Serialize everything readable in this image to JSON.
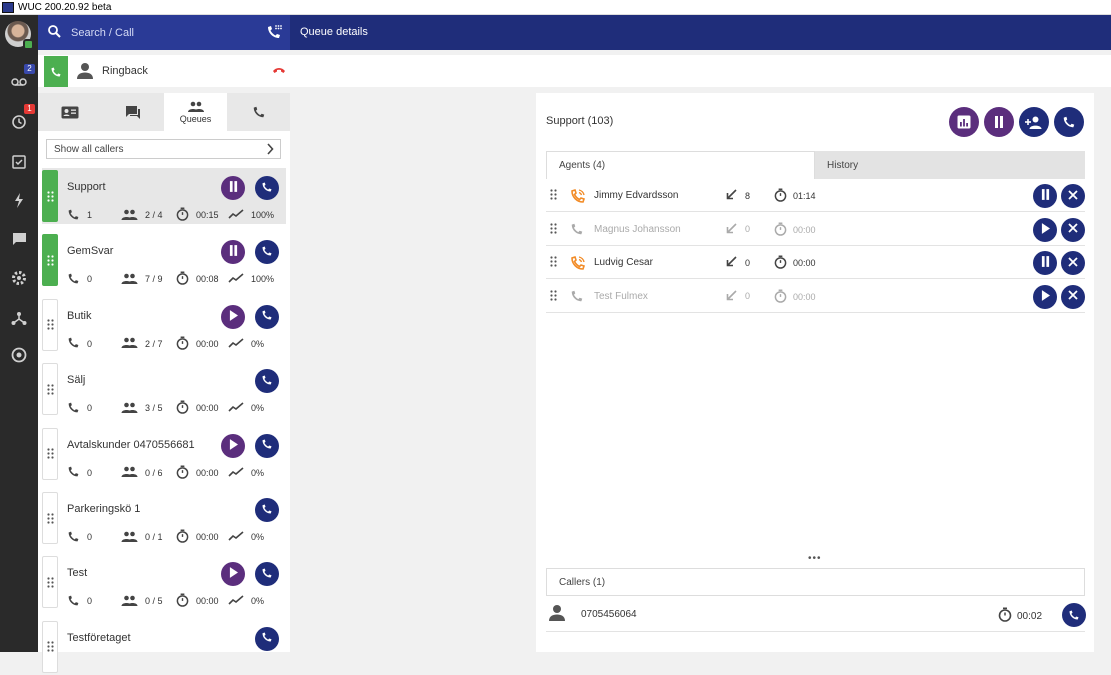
{
  "window": {
    "title": "WUC 200.20.92 beta"
  },
  "nav": {
    "badges": {
      "voicemail": "2",
      "history": "1"
    },
    "icons": [
      "voicemail-icon",
      "history-icon",
      "tasks-icon",
      "flash-icon",
      "chat-icon",
      "settings-icon",
      "network-icon",
      "support-icon"
    ]
  },
  "search": {
    "placeholder": "Search / Call"
  },
  "header": {
    "title": "Queue details"
  },
  "call": {
    "label": "Ringback"
  },
  "tabs": {
    "queues_label": "Queues"
  },
  "filter": {
    "label": "Show all callers"
  },
  "queues": [
    {
      "name": "Support",
      "calls": "1",
      "agents": "2 / 4",
      "time": "00:15",
      "rate": "100%",
      "state": "active",
      "action": "pause"
    },
    {
      "name": "GemSvar",
      "calls": "0",
      "agents": "7 / 9",
      "time": "00:08",
      "rate": "100%",
      "state": "active",
      "action": "pause"
    },
    {
      "name": "Butik",
      "calls": "0",
      "agents": "2 / 7",
      "time": "00:00",
      "rate": "0%",
      "state": "inactive",
      "action": "play"
    },
    {
      "name": "Sälj",
      "calls": "0",
      "agents": "3 / 5",
      "time": "00:00",
      "rate": "0%",
      "state": "inactive",
      "action": "none"
    },
    {
      "name": "Avtalskunder 0470556681",
      "calls": "0",
      "agents": "0 / 6",
      "time": "00:00",
      "rate": "0%",
      "state": "inactive",
      "action": "play"
    },
    {
      "name": "Parkeringskö 1",
      "calls": "0",
      "agents": "0 / 1",
      "time": "00:00",
      "rate": "0%",
      "state": "inactive",
      "action": "none"
    },
    {
      "name": "Test",
      "calls": "0",
      "agents": "0 / 5",
      "time": "00:00",
      "rate": "0%",
      "state": "inactive",
      "action": "play"
    },
    {
      "name": "Testföretaget",
      "calls": "",
      "agents": "",
      "time": "",
      "rate": "",
      "state": "inactive",
      "action": "none"
    }
  ],
  "detail": {
    "title": "Support (103)",
    "tab_agents": "Agents (4)",
    "tab_history": "History",
    "agents": [
      {
        "name": "Jimmy Edvardsson",
        "missed": "8",
        "time": "01:14",
        "status": "active",
        "action": "pause"
      },
      {
        "name": "Magnus Johansson",
        "missed": "0",
        "time": "00:00",
        "status": "inactive",
        "action": "play"
      },
      {
        "name": "Ludvig Cesar",
        "missed": "0",
        "time": "00:00",
        "status": "active",
        "action": "pause"
      },
      {
        "name": "Test Fulmex",
        "missed": "0",
        "time": "00:00",
        "status": "inactive",
        "action": "play"
      }
    ],
    "callers_label": "Callers (1)",
    "callers": [
      {
        "number": "0705456064",
        "time": "00:02"
      }
    ]
  },
  "colors": {
    "navy": "#1f2d7a",
    "purple": "#5b2e7d",
    "green": "#4caf50",
    "orange": "#f28c28",
    "red": "#e53935",
    "sidebar": "#2a2a2a"
  }
}
